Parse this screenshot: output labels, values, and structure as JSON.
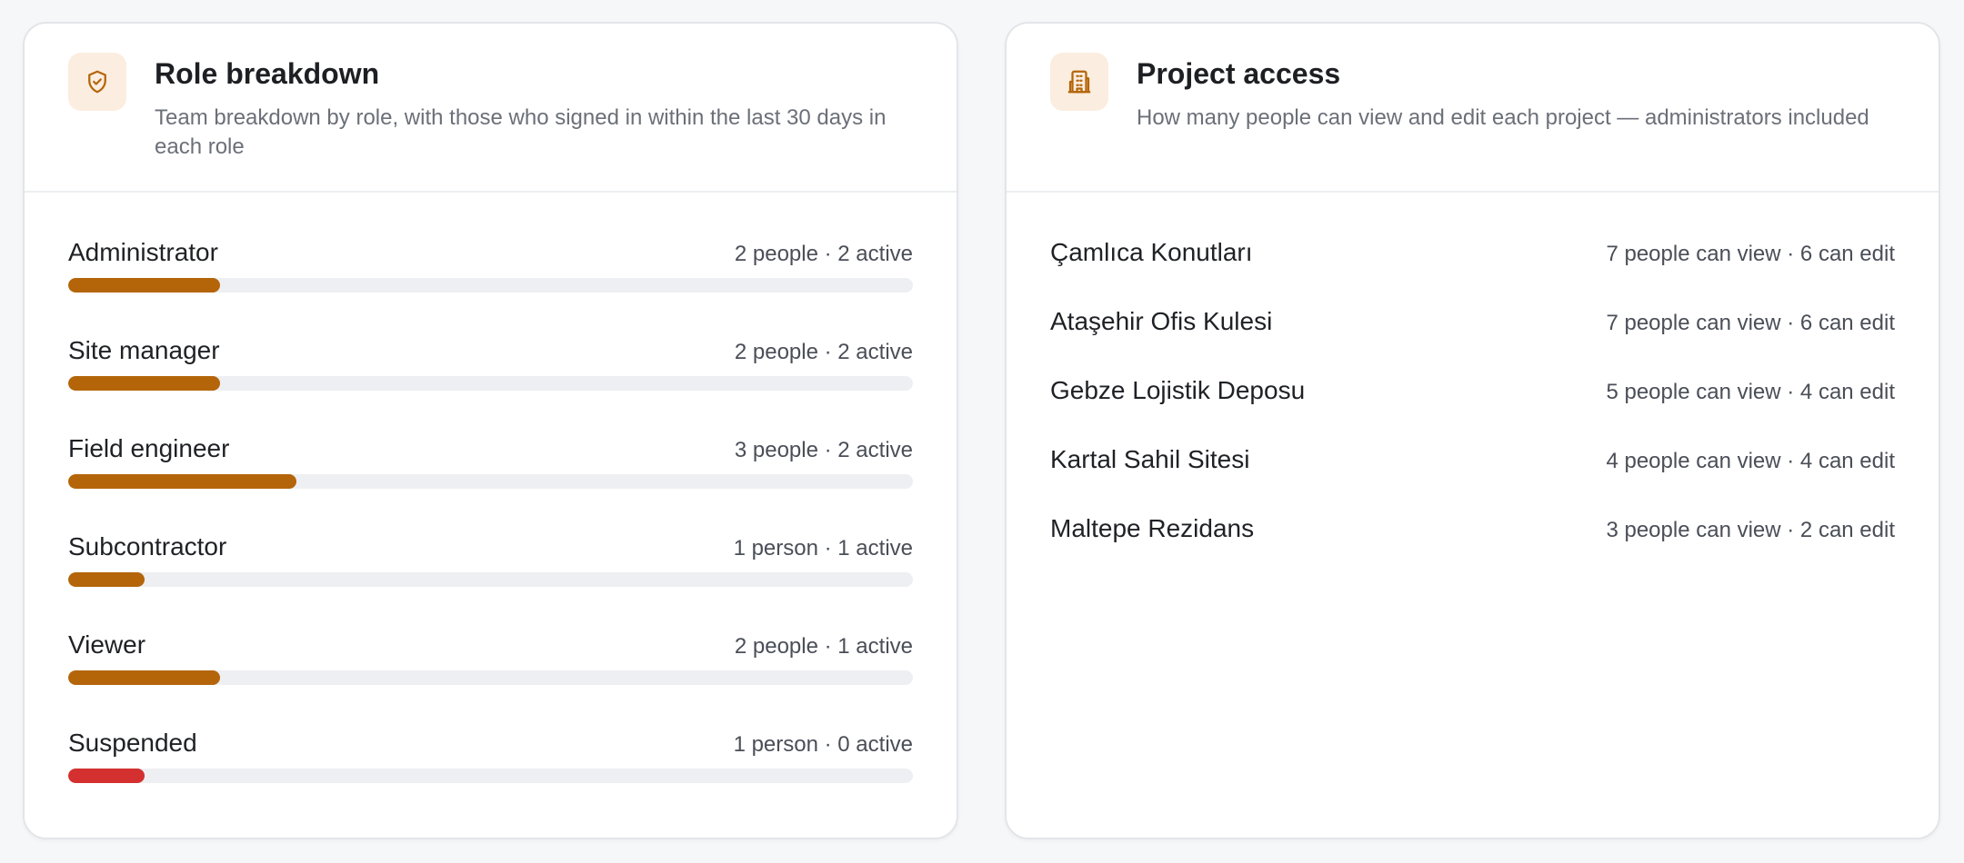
{
  "roles_card": {
    "title": "Role breakdown",
    "subtitle": "Team breakdown by role, with those who signed in within the last 30 days in each role",
    "icon": "shield-check-icon",
    "accent_color": "#b4650a",
    "icon_bg_color": "#fbeddf",
    "danger_color": "#d3302f",
    "roles": [
      {
        "name": "Administrator",
        "meta": "2 people · 2 active",
        "count": 2,
        "active": 2,
        "share": 0.18,
        "status": "normal"
      },
      {
        "name": "Site manager",
        "meta": "2 people · 2 active",
        "count": 2,
        "active": 2,
        "share": 0.18,
        "status": "normal"
      },
      {
        "name": "Field engineer",
        "meta": "3 people · 2 active",
        "count": 3,
        "active": 2,
        "share": 0.27,
        "status": "normal"
      },
      {
        "name": "Subcontractor",
        "meta": "1 person · 1 active",
        "count": 1,
        "active": 1,
        "share": 0.09,
        "status": "normal"
      },
      {
        "name": "Viewer",
        "meta": "2 people · 1 active",
        "count": 2,
        "active": 1,
        "share": 0.18,
        "status": "normal"
      },
      {
        "name": "Suspended",
        "meta": "1 person · 0 active",
        "count": 1,
        "active": 0,
        "share": 0.09,
        "status": "danger"
      }
    ]
  },
  "projects_card": {
    "title": "Project access",
    "subtitle": "How many people can view and edit each project — administrators included",
    "icon": "building-icon",
    "projects": [
      {
        "name": "Çamlıca Konutları",
        "meta": "7 people can view · 6 can edit"
      },
      {
        "name": "Ataşehir Ofis Kulesi",
        "meta": "7 people can view · 6 can edit"
      },
      {
        "name": "Gebze Lojistik Deposu",
        "meta": "5 people can view · 4 can edit"
      },
      {
        "name": "Kartal Sahil Sitesi",
        "meta": "4 people can view · 4 can edit"
      },
      {
        "name": "Maltepe Rezidans",
        "meta": "3 people can view · 2 can edit"
      }
    ]
  }
}
